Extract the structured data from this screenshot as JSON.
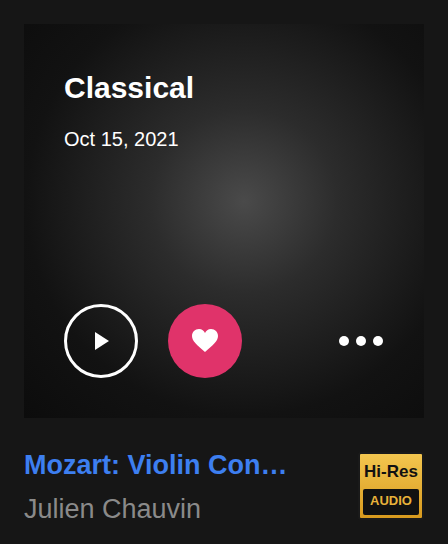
{
  "album": {
    "genre": "Classical",
    "date": "Oct 15, 2021",
    "title": "Mozart: Violin Con…",
    "artist": "Julien Chauvin",
    "favorite": true
  },
  "badge": {
    "line1": "Hi-Res",
    "line2": "AUDIO"
  }
}
